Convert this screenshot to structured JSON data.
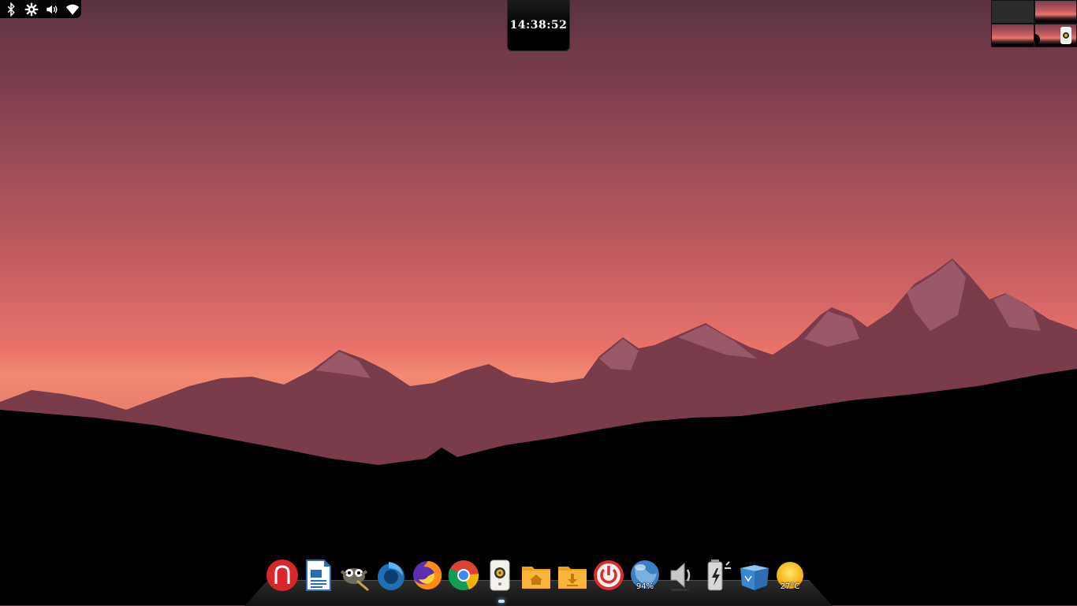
{
  "top_bar": {
    "tray_icons": [
      "bluetooth-icon",
      "settings-gear-icon",
      "volume-icon",
      "wifi-icon"
    ]
  },
  "clock": {
    "time": "14:38:52"
  },
  "workspace_pager": {
    "workspaces": [
      "empty",
      "wallpaper",
      "wallpaper",
      "active"
    ],
    "active_badge": "1"
  },
  "dock": {
    "items": [
      {
        "name": "launcher",
        "icon": "red-arch-icon"
      },
      {
        "name": "libreoffice-writer",
        "icon": "document-icon"
      },
      {
        "name": "gimp",
        "icon": "gimp-icon"
      },
      {
        "name": "thunderbird",
        "icon": "bird-icon"
      },
      {
        "name": "firefox",
        "icon": "firefox-icon"
      },
      {
        "name": "chrome",
        "icon": "chrome-icon"
      },
      {
        "name": "music-player",
        "icon": "speaker-icon"
      },
      {
        "name": "home-folder",
        "icon": "home-folder-icon"
      },
      {
        "name": "downloads-folder",
        "icon": "downloads-folder-icon"
      },
      {
        "name": "power",
        "icon": "power-icon"
      },
      {
        "name": "network",
        "icon": "globe-icon",
        "label": "94%"
      },
      {
        "name": "volume",
        "icon": "speaker-volume-icon"
      },
      {
        "name": "battery",
        "icon": "battery-charging-icon"
      },
      {
        "name": "trash",
        "icon": "recycle-bin-icon"
      },
      {
        "name": "weather",
        "icon": "sun-icon",
        "label": "27°C"
      }
    ]
  },
  "colors": {
    "sky_top": "#5a3340",
    "sky_glow": "#f28a72",
    "mountains": "#7a3a4a",
    "snow": "#c98a98",
    "forest": "#000000"
  }
}
